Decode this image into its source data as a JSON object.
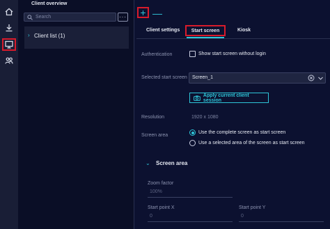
{
  "rail": {
    "items": [
      {
        "icon": "home-icon"
      },
      {
        "icon": "download-icon"
      },
      {
        "icon": "monitor-icon",
        "active": true
      },
      {
        "icon": "users-icon"
      }
    ]
  },
  "sidepanel": {
    "title": "Client overview",
    "search_placeholder": "Search",
    "more_label": "···",
    "client_list_label": "Client list (1)"
  },
  "toolbar": {
    "add_label": "+",
    "remove_label": "—"
  },
  "tabs": [
    {
      "label": "Client settings"
    },
    {
      "label": "Start screen",
      "active": true
    },
    {
      "label": "Kiosk"
    }
  ],
  "form": {
    "authentication_label": "Authentication",
    "show_start_screen_label": "Show start screen without login",
    "selected_start_screen_label": "Selected start screen",
    "selected_start_screen_value": "Screen_1",
    "apply_button_label": "Apply current client session",
    "resolution_label": "Resolution",
    "resolution_value": "1920 x 1080",
    "screen_area_label": "Screen area",
    "screen_area_options": [
      {
        "label": "Use the complete screen as start screen",
        "selected": true
      },
      {
        "label": "Use a selected area of the screen as start screen",
        "selected": false
      }
    ]
  },
  "screen_area_section": {
    "title": "Screen area",
    "zoom_factor_label": "Zoom factor",
    "zoom_factor_value": "100%",
    "start_point_x_label": "Start point X",
    "start_point_x_value": "0",
    "start_point_y_label": "Start point Y",
    "start_point_y_value": "0"
  },
  "colors": {
    "accent": "#2ec6d9",
    "highlight": "#d81b2b",
    "background": "#0c1130"
  }
}
